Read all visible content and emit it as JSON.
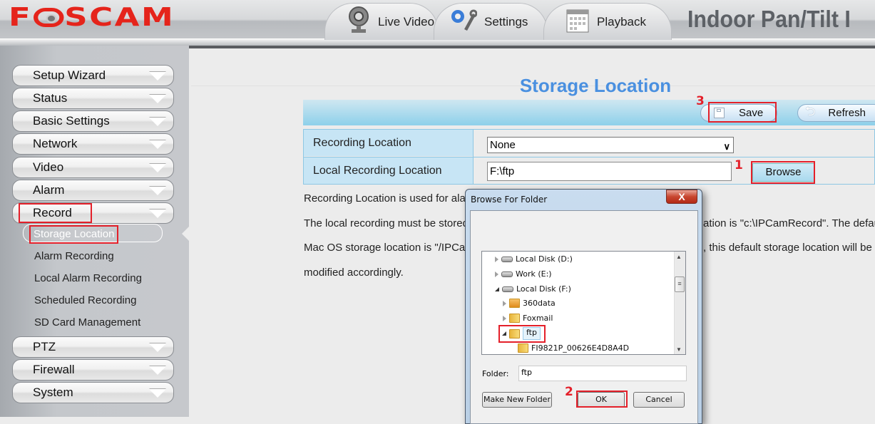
{
  "header": {
    "logo": "FOSCAM",
    "tabs": [
      {
        "label": "Live Video",
        "icon": "webcam-icon"
      },
      {
        "label": "Settings",
        "icon": "gears-wrench-icon"
      },
      {
        "label": "Playback",
        "icon": "calendar-icon"
      }
    ],
    "product_title": "Indoor Pan/Tilt I"
  },
  "sidebar": {
    "menu_top": [
      {
        "label": "Setup Wizard"
      },
      {
        "label": "Status"
      },
      {
        "label": "Basic Settings"
      },
      {
        "label": "Network"
      },
      {
        "label": "Video"
      },
      {
        "label": "Alarm"
      },
      {
        "label": "Record",
        "expanded": true
      }
    ],
    "submenu": [
      {
        "label": "Storage Location",
        "active": true
      },
      {
        "label": "Alarm Recording"
      },
      {
        "label": "Local Alarm Recording"
      },
      {
        "label": "Scheduled Recording"
      },
      {
        "label": "SD Card Management"
      }
    ],
    "menu_bottom": [
      {
        "label": "PTZ"
      },
      {
        "label": "Firewall"
      },
      {
        "label": "System"
      }
    ]
  },
  "main": {
    "page_title": "Storage Location",
    "toolbar": {
      "save_label": "Save",
      "refresh_label": "Refresh"
    },
    "form": {
      "recording_location_label": "Recording Location",
      "recording_location_value": "None",
      "local_recording_location_label": "Local Recording Location",
      "local_recording_location_value": "F:\\ftp",
      "browse_label": "Browse"
    },
    "description": [
      "Recording Location is used for ala",
      "The local recording must be stored",
      "Mac OS storage location is \"/IPCa",
      "modified accordingly."
    ],
    "description_right": [
      "ation is \"c:\\IPCamRecord\". The defau",
      ", this default storage location will be"
    ]
  },
  "annotations": {
    "step1": "1",
    "step2": "2",
    "step3": "3"
  },
  "dialog": {
    "title": "Browse For Folder",
    "close_label": "X",
    "tree": [
      {
        "label": "Local Disk (D:)",
        "type": "drive",
        "expanded": false
      },
      {
        "label": "Work (E:)",
        "type": "drive",
        "expanded": false
      },
      {
        "label": "Local Disk (F:)",
        "type": "drive",
        "expanded": true
      },
      {
        "label": "360data",
        "type": "folder",
        "expanded": false
      },
      {
        "label": "Foxmail",
        "type": "folder",
        "expanded": false
      },
      {
        "label": "ftp",
        "type": "folder",
        "expanded": true,
        "selected": true
      },
      {
        "label": "FI9821P_00626E4D8A4D",
        "type": "folder"
      }
    ],
    "folder_label": "Folder:",
    "folder_value": "ftp",
    "make_new_folder_label": "Make New Folder",
    "ok_label": "OK",
    "cancel_label": "Cancel"
  },
  "colors": {
    "brand_red": "#e5241b",
    "title_blue": "#4a90e0",
    "annotation_red": "#e4202a"
  }
}
